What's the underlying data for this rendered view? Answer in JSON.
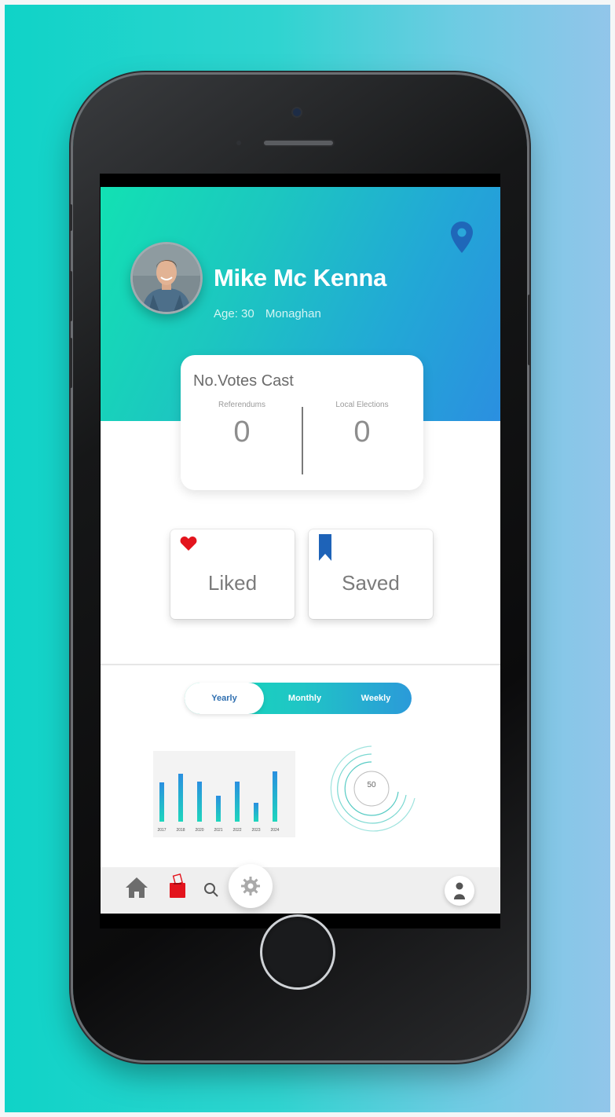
{
  "profile": {
    "name": "Mike Mc Kenna",
    "age_text": "Age: 30",
    "location": "Monaghan",
    "avatar_icon": "user-photo-avatar"
  },
  "votes_card": {
    "title": "No.Votes Cast",
    "columns": [
      {
        "label": "Referendums",
        "value": "0"
      },
      {
        "label": "Local Elections",
        "value": "0"
      }
    ]
  },
  "tiles": {
    "liked": {
      "label": "Liked",
      "icon": "heart-icon",
      "color": "#e3141d"
    },
    "saved": {
      "label": "Saved",
      "icon": "bookmark-icon",
      "color": "#1e63b8"
    }
  },
  "period_tabs": {
    "items": [
      "Yearly",
      "Monthly",
      "Weekly"
    ],
    "selected": "Yearly"
  },
  "chart_data": {
    "type": "bar",
    "categories": [
      "2017",
      "2018",
      "2020",
      "2021",
      "2022",
      "2023",
      "2024"
    ],
    "values": [
      0.78,
      0.96,
      0.8,
      0.52,
      0.8,
      0.38,
      1.0
    ],
    "ylim": [
      0,
      1
    ],
    "title": "",
    "xlabel": "",
    "ylabel": "",
    "grid": false
  },
  "progress_ring": {
    "value": "50"
  },
  "bottom_nav": {
    "items": [
      "home-icon",
      "ballot-box-icon",
      "search-icon",
      "gear-icon",
      "profile-icon"
    ]
  },
  "colors": {
    "header_start": "#12e1b3",
    "header_end": "#2b8fe0",
    "pin": "#1f67b9",
    "accent_blue": "#2f6fb0"
  }
}
